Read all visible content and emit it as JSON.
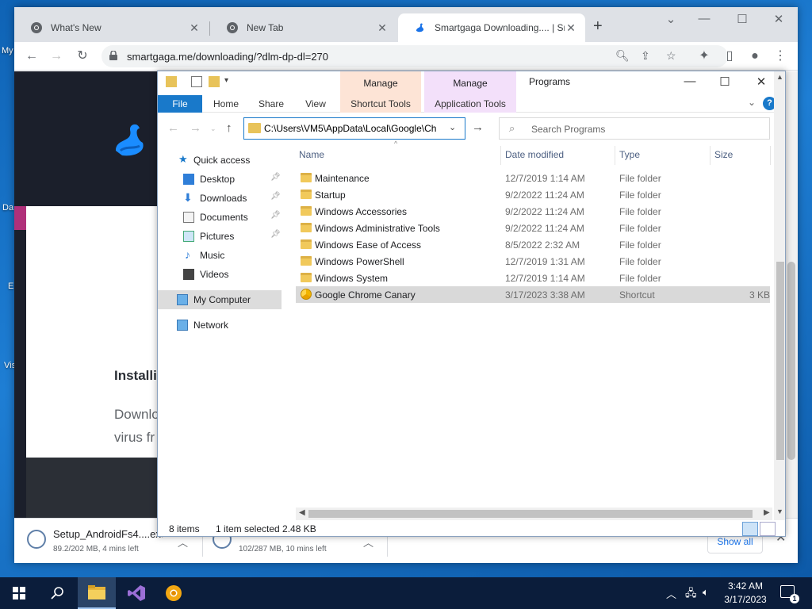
{
  "desktop": {
    "fragments": [
      "My",
      "Da",
      "E",
      "Vis"
    ]
  },
  "chrome": {
    "tabs": [
      {
        "title": "What's New",
        "active": false
      },
      {
        "title": "New Tab",
        "active": false
      },
      {
        "title": "Smartgaga Downloading.... | Sm",
        "active": true
      }
    ],
    "url": "smartgaga.me/downloading/?dlm-dp-dl=270",
    "page": {
      "heading": "Installi",
      "paragraph_lines": [
        "Downlo",
        "virus fr"
      ]
    },
    "downloads": [
      {
        "name": "Setup_AndroidFs4....exe",
        "status": "89.2/202 MB, 4 mins left"
      },
      {
        "name": "",
        "status": "102/287 MB, 10 mins left"
      }
    ],
    "show_all": "Show all"
  },
  "explorer": {
    "title": "Programs",
    "context_tabs": [
      {
        "group": "Manage",
        "tab": "Shortcut Tools",
        "color": "#fde4d6"
      },
      {
        "group": "Manage",
        "tab": "Application Tools",
        "color": "#f3e0fa"
      }
    ],
    "ribbon_tabs": [
      "File",
      "Home",
      "Share",
      "View"
    ],
    "address": "C:\\Users\\VM5\\AppData\\Local\\Google\\Ch",
    "search_placeholder": "Search Programs",
    "nav": {
      "quick_access": "Quick access",
      "pinned": [
        "Desktop",
        "Downloads",
        "Documents",
        "Pictures"
      ],
      "others": [
        "Music",
        "Videos"
      ],
      "my_computer": "My Computer",
      "network": "Network"
    },
    "columns": [
      "Name",
      "Date modified",
      "Type",
      "Size"
    ],
    "rows": [
      {
        "name": "Maintenance",
        "date": "12/7/2019 1:14 AM",
        "type": "File folder",
        "size": "",
        "kind": "folder"
      },
      {
        "name": "Startup",
        "date": "9/2/2022 11:24 AM",
        "type": "File folder",
        "size": "",
        "kind": "folder"
      },
      {
        "name": "Windows Accessories",
        "date": "9/2/2022 11:24 AM",
        "type": "File folder",
        "size": "",
        "kind": "folder"
      },
      {
        "name": "Windows Administrative Tools",
        "date": "9/2/2022 11:24 AM",
        "type": "File folder",
        "size": "",
        "kind": "folder"
      },
      {
        "name": "Windows Ease of Access",
        "date": "8/5/2022 2:32 AM",
        "type": "File folder",
        "size": "",
        "kind": "folder"
      },
      {
        "name": "Windows PowerShell",
        "date": "12/7/2019 1:31 AM",
        "type": "File folder",
        "size": "",
        "kind": "folder"
      },
      {
        "name": "Windows System",
        "date": "12/7/2019 1:14 AM",
        "type": "File folder",
        "size": "",
        "kind": "folder"
      },
      {
        "name": "Google Chrome Canary",
        "date": "3/17/2023 3:38 AM",
        "type": "Shortcut",
        "size": "3 KB",
        "kind": "shortcut",
        "selected": true
      }
    ],
    "status": {
      "items": "8 items",
      "selected": "1 item selected  2.48 KB"
    }
  },
  "taskbar": {
    "time": "3:42 AM",
    "date": "3/17/2023",
    "notification_count": "1"
  }
}
